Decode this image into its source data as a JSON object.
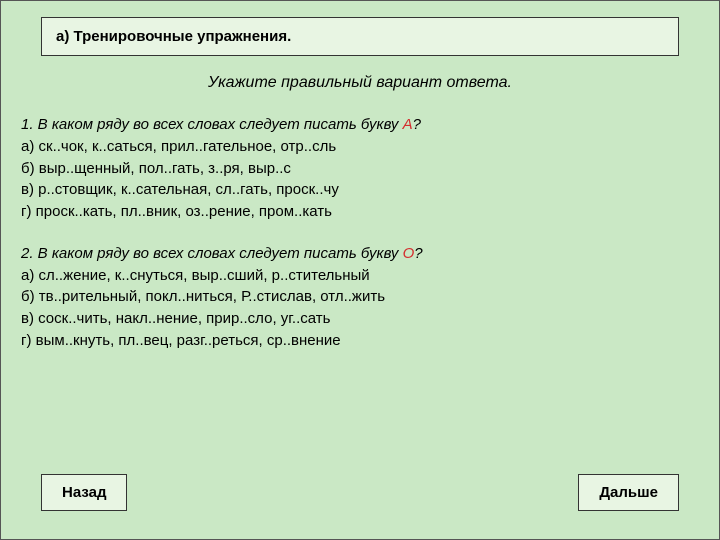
{
  "header": "а) Тренировочные упражнения.",
  "instruction": "Укажите правильный вариант ответа.",
  "q1": {
    "prompt_pre": "1. В каком ряду во всех словах следует писать букву ",
    "prompt_hl": "А",
    "prompt_post": "?",
    "a": "а) ск..чок, к..саться, прил..гательное, отр..сль",
    "b": "б) выр..щенный, пол..гать, з..ря, выр..с",
    "c": "в) р..стовщик, к..сательная, сл..гать, проск..чу",
    "d": "г) проск..кать, пл..вник, оз..рение, пром..кать"
  },
  "q2": {
    "prompt_pre": "2. В каком ряду во всех словах следует писать букву ",
    "prompt_hl": "О",
    "prompt_post": "?",
    "a": "а) сл..жение, к..снуться, выр..сший, р..стительный",
    "b": "б) тв..рительный, покл..ниться, Р..стислав, отл..жить",
    "c": "в) соск..чить, накл..нение, прир..сло, уг..сать",
    "d": "г) вым..кнуть, пл..вец, разг..реться, ср..внение"
  },
  "buttons": {
    "back": "Назад",
    "next": "Дальше"
  }
}
